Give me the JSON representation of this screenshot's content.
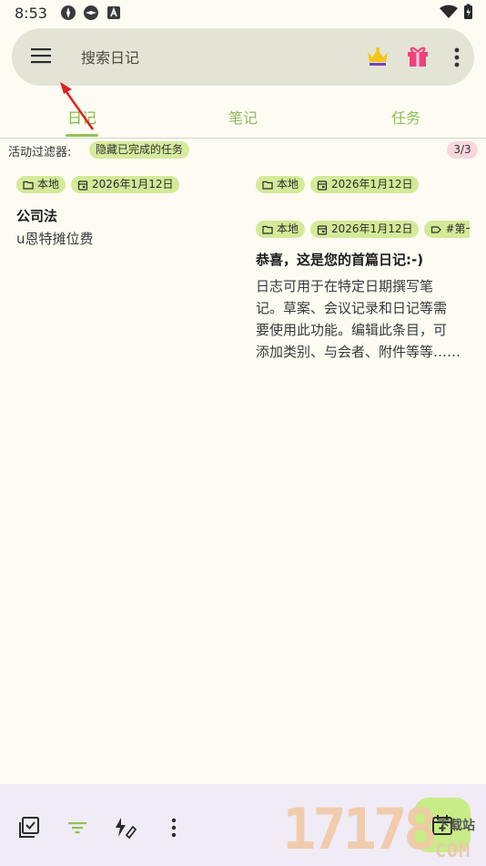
{
  "status_bar": {
    "time": "8:53"
  },
  "search": {
    "placeholder": "搜索日记"
  },
  "tabs": [
    {
      "label": "日记",
      "active": true
    },
    {
      "label": "笔记",
      "active": false
    },
    {
      "label": "任务",
      "active": false
    }
  ],
  "filter": {
    "label": "活动过滤器:",
    "chip": "隐藏已完成的任务",
    "count": "3/3"
  },
  "cards": [
    {
      "chips": [
        {
          "icon": "folder-icon",
          "text": "本地"
        },
        {
          "icon": "calendar-icon",
          "text": "2026年1月12日"
        }
      ],
      "title": "公司法",
      "body": "u恩特摊位费"
    },
    {
      "chips": [
        {
          "icon": "folder-icon",
          "text": "本地"
        },
        {
          "icon": "calendar-icon",
          "text": "2026年1月12日"
        }
      ],
      "title": "",
      "body": ""
    },
    {
      "chips": [
        {
          "icon": "folder-icon",
          "text": "本地"
        },
        {
          "icon": "calendar-icon",
          "text": "2026年1月12日"
        },
        {
          "icon": "tag-icon",
          "text": "#第一"
        }
      ],
      "title": "恭喜，这是您的首篇日记:-)",
      "body_lines": [
        "日志可用于在特定日期撰写笔",
        "记。草案、会议记录和日记等需",
        "要使用此功能。编辑此条目，可",
        "添加类别、与会者、附件等等……"
      ]
    }
  ],
  "watermark": {
    "digits": "17178",
    "site": "下载站",
    "domain": "COM"
  },
  "colors": {
    "accent": "#8fc256",
    "chip": "#d3ea98",
    "fab": "#c8ec88",
    "search_bg": "#e3e4d5",
    "bottom_bar": "#f0ebf4"
  }
}
